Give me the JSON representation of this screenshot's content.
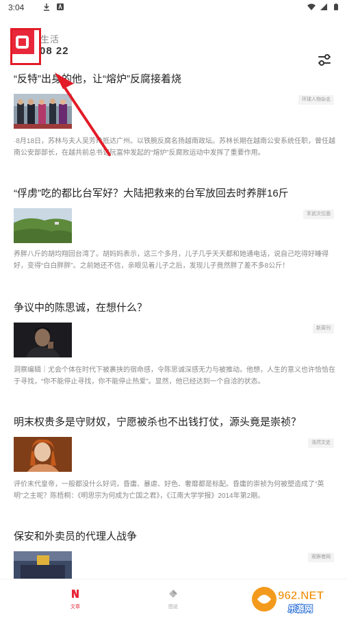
{
  "status_bar": {
    "time": "3:04"
  },
  "header": {
    "label": "生活",
    "date": "08 22"
  },
  "articles": [
    {
      "title": "“反特”出身的他，让“熔炉”反腐接着烧",
      "source": "环球人物杂志",
      "summary": "·8月18日，苏林与夫人吴芳玲抵达广州。以铁腕反腐名扬越南政坛。苏林长期在越南公安系统任职，曾任越南公安部部长，在越共前总书记阮富仲发起的“熔炉”反腐败运动中发挥了重要作用。"
    },
    {
      "title": "“俘虏”吃的都比台军好？大陆把救来的台军放回去时养胖16斤",
      "source": "军武次位面",
      "summary": "养胖八斤的胡均翔回台湾了。胡妈妈表示，这三个多月，儿子几乎天天都和她通电话，说自己吃得好睡得好，变得“白白胖胖”。之前她还不信，亲眼见着儿子之后，发现儿子竟然胖了差不多8公斤！"
    },
    {
      "title": "争议中的陈思诚，在想什么？",
      "source": "新周刊",
      "summary": "洞察编辑｜尤会个体在时代下被裹挟的宿命感，令陈思诚深感无力与被推动。他想，人生的意义也许恰恰在于寻找，“你不能停止寻找，你不能停止热爱”。显然，他已经达到一个自洽的状态。"
    },
    {
      "title": "明末权贵多是守财奴，宁愿被杀也不出钱打仗，源头竟是崇祯？",
      "source": "浩然文史",
      "summary": "评价末代皇帝，一般都没什么好词，昏庸、暴虐、好色、奢靡都是标配。昏庸的崇祯为何被塑造成了“英明”之主呢？陈梧桐：《明思宗为何成为亡国之君》，《江南大学学报》2014年第2期。"
    },
    {
      "title": "保安和外卖员的代理人战争",
      "source": "观察者网",
      "summary": ""
    }
  ],
  "bottom_nav": {
    "items": [
      {
        "label": "文章",
        "color": "#e8283a"
      },
      {
        "label": "图说",
        "color": "#aaaaaa"
      }
    ]
  },
  "watermark": {
    "brand": "962.NET",
    "site": "乐游网"
  },
  "colors": {
    "accent": "#e8283a",
    "annotation": "#e21b27"
  }
}
